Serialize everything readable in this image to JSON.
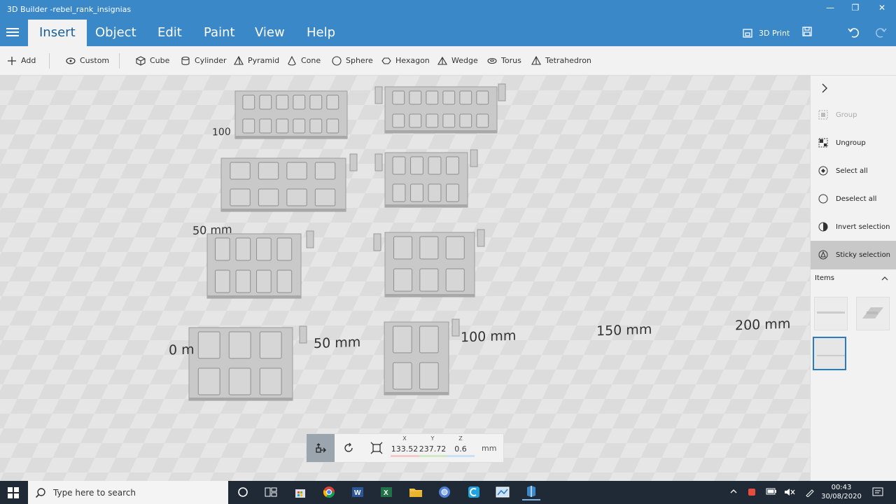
{
  "window": {
    "title": "3D Builder -rebel_rank_insignias",
    "minimize": "—",
    "maximize": "❐",
    "close": "✕"
  },
  "menu": {
    "tabs": [
      "Insert",
      "Object",
      "Edit",
      "Paint",
      "View",
      "Help"
    ],
    "active_tab": "Insert",
    "print_label": "3D Print"
  },
  "toolbar": {
    "add": "Add",
    "custom": "Custom",
    "shapes": [
      "Cube",
      "Cylinder",
      "Pyramid",
      "Cone",
      "Sphere",
      "Hexagon",
      "Wedge",
      "Torus",
      "Tetrahedron"
    ]
  },
  "viewport": {
    "axis_labels": [
      "100",
      "50 mm",
      "0 m",
      "50 mm",
      "100 mm",
      "150 mm",
      "200 mm"
    ]
  },
  "transform": {
    "x_label": "X",
    "y_label": "Y",
    "z_label": "Z",
    "x": "133.52",
    "y": "237.72",
    "z": "0.6",
    "unit": "mm"
  },
  "rightpanel": {
    "actions": [
      {
        "label": "Group",
        "state": "disabled"
      },
      {
        "label": "Ungroup",
        "state": "enabled"
      },
      {
        "label": "Select all",
        "state": "enabled"
      },
      {
        "label": "Deselect all",
        "state": "enabled"
      },
      {
        "label": "Invert selection",
        "state": "enabled"
      },
      {
        "label": "Sticky selection",
        "state": "active"
      }
    ],
    "items_title": "Items"
  },
  "taskbar": {
    "search_placeholder": "Type here to search",
    "time": "00:43",
    "date": "30/08/2020"
  },
  "colors": {
    "accent": "#3a88c8",
    "toolbar_bg": "#f2f2f2",
    "taskbar_bg": "#1f2a36",
    "selection": "#2a7bc4"
  }
}
